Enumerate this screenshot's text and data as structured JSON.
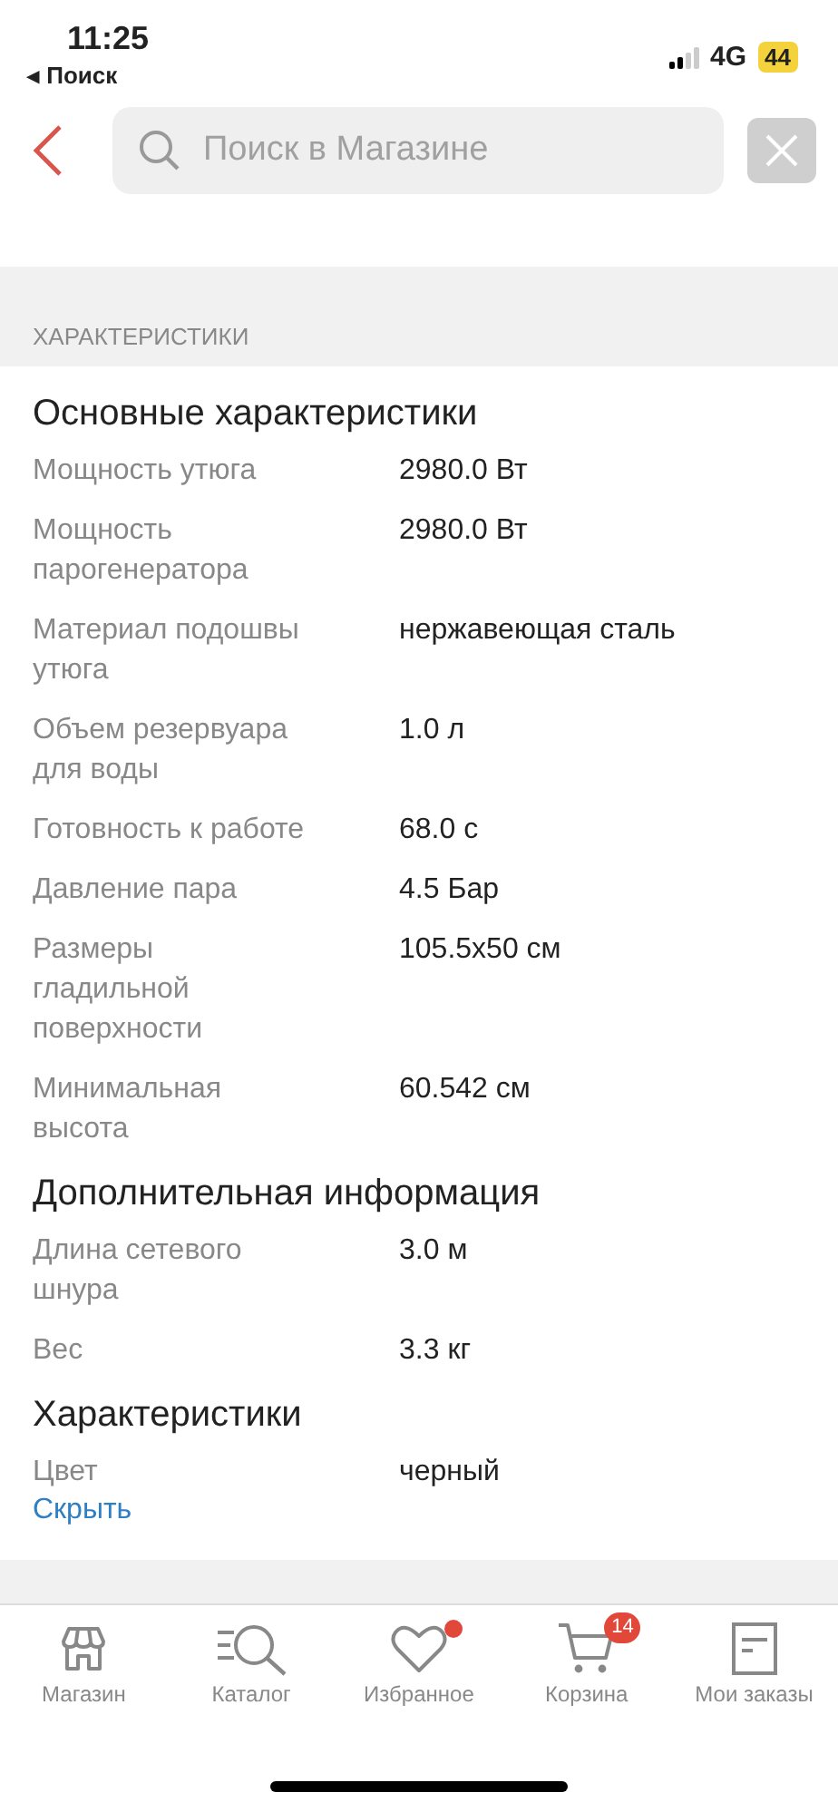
{
  "status_bar": {
    "time": "11:25",
    "back_link": "◂ Поиск",
    "network": "4G",
    "battery": "44"
  },
  "header": {
    "search": {
      "placeholder": "Поиск в Магазине"
    }
  },
  "section_title": "ХАРАКТЕРИСТИКИ",
  "groups": [
    {
      "title": "Основные характеристики",
      "rows": [
        {
          "name": "Мощность утюга",
          "value": "2980.0 Вт"
        },
        {
          "name": "Мощность парогенератора",
          "value": "2980.0 Вт"
        },
        {
          "name": "Материал подошвы утюга",
          "value": "нержавеющая сталь"
        },
        {
          "name": "Объем резервуара для воды",
          "value": "1.0 л"
        },
        {
          "name": "Готовность к работе",
          "value": "68.0 с"
        },
        {
          "name": "Давление пара",
          "value": "4.5 Бар"
        },
        {
          "name": "Размеры гладильной поверхности",
          "value": "105.5x50 см"
        },
        {
          "name": "Минимальная высота",
          "value": "60.542 см"
        }
      ]
    },
    {
      "title": "Дополнительная информация",
      "rows": [
        {
          "name": "Длина сетевого шнура",
          "value": "3.0 м"
        },
        {
          "name": "Вес",
          "value": "3.3 кг"
        }
      ]
    },
    {
      "title": "Характеристики",
      "rows": [
        {
          "name": "Цвет",
          "value": "черный"
        }
      ]
    }
  ],
  "hide_link": "Скрыть",
  "nav": [
    {
      "kind": "store",
      "label": "Магазин",
      "dot": false
    },
    {
      "kind": "catalog",
      "label": "Каталог",
      "dot": false
    },
    {
      "kind": "favorites",
      "label": "Избранное",
      "dot": true
    },
    {
      "kind": "cart",
      "label": "Корзина",
      "dot": false,
      "badge": "14"
    },
    {
      "kind": "orders",
      "label": "Мои заказы",
      "dot": false
    }
  ]
}
